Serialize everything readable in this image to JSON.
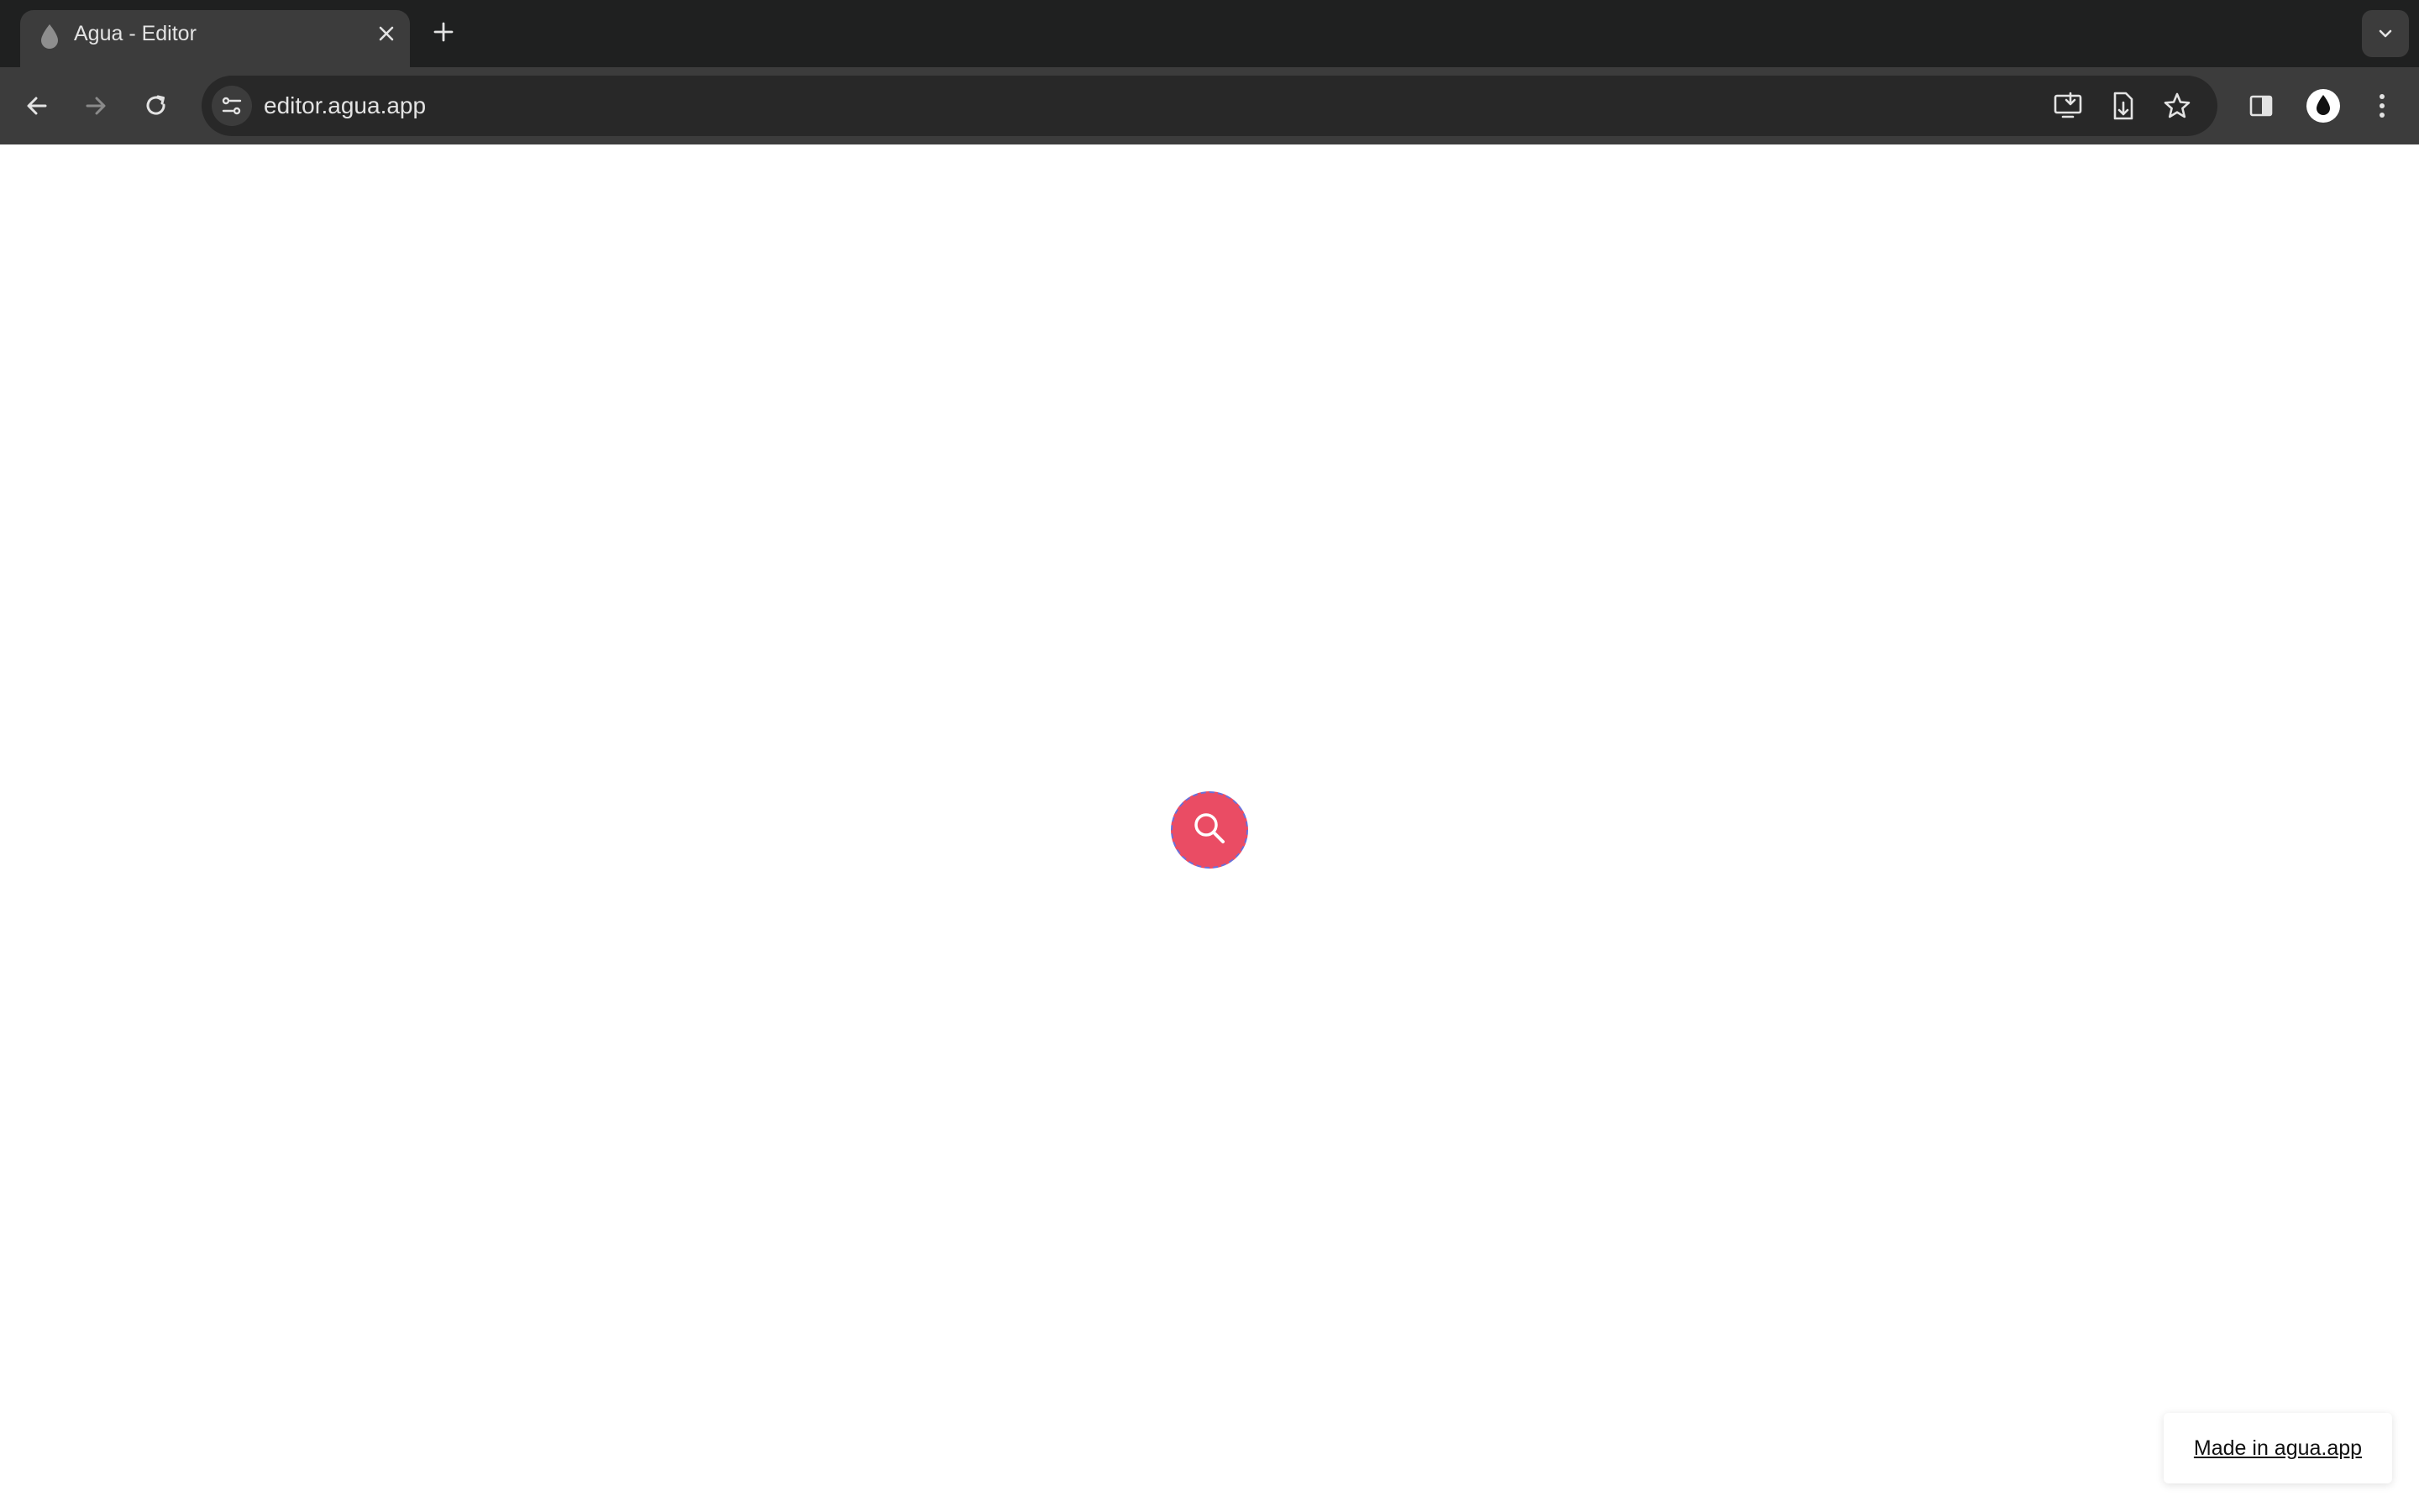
{
  "browser": {
    "tab": {
      "title": "Agua - Editor",
      "favicon": "water-drop-icon",
      "close_icon": "close-icon"
    },
    "new_tab_icon": "plus-icon",
    "tab_search_icon": "chevron-down-icon",
    "nav": {
      "back_icon": "arrow-left-icon",
      "forward_icon": "arrow-right-icon",
      "reload_icon": "reload-icon"
    },
    "omnibox": {
      "url": "editor.agua.app",
      "site_info_icon": "tune-icon",
      "install_icon": "install-app-icon",
      "page_save_icon": "save-page-icon",
      "bookmark_icon": "star-icon"
    },
    "side_panel_icon": "side-panel-icon",
    "profile_icon": "water-drop-profile-icon",
    "menu_icon": "kebab-menu-icon"
  },
  "page": {
    "fab": {
      "icon": "search-icon",
      "color": "#ea4c64",
      "outline_color": "#6a6fd8"
    },
    "badge": {
      "label": "Made in agua.app"
    }
  },
  "colors": {
    "chrome_dark": "#1f2020",
    "chrome_toolbar": "#3c3c3c",
    "omnibox_bg": "#282828",
    "chrome_text": "#e3e3e3"
  }
}
